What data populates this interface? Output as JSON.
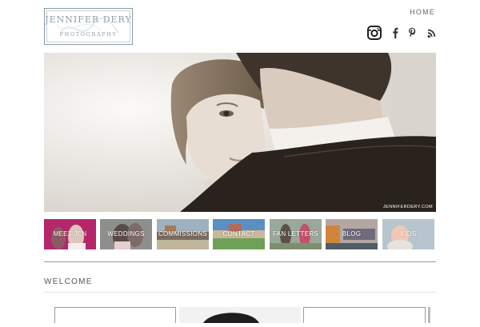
{
  "header": {
    "logo": {
      "name": "JENNIFER DERY",
      "sub": "PHOTOGRAPHY"
    },
    "nav": {
      "home": "HOME"
    },
    "social": [
      "instagram-icon",
      "facebook-icon",
      "pinterest-icon",
      "rss-icon"
    ]
  },
  "hero": {
    "credit": "JENNIFERDERY.COM"
  },
  "tiles": [
    {
      "label": "MEET JEN"
    },
    {
      "label": "WEDDINGS"
    },
    {
      "label": "COMMISSIONS"
    },
    {
      "label": "CONTACT"
    },
    {
      "label": "FAN LETTERS"
    },
    {
      "label": "BLOG"
    },
    {
      "label": "KIDS"
    }
  ],
  "section": {
    "title": "WELCOME"
  },
  "colors": {
    "accent": "#8ea0aa",
    "rule": "#9a9a9a"
  }
}
